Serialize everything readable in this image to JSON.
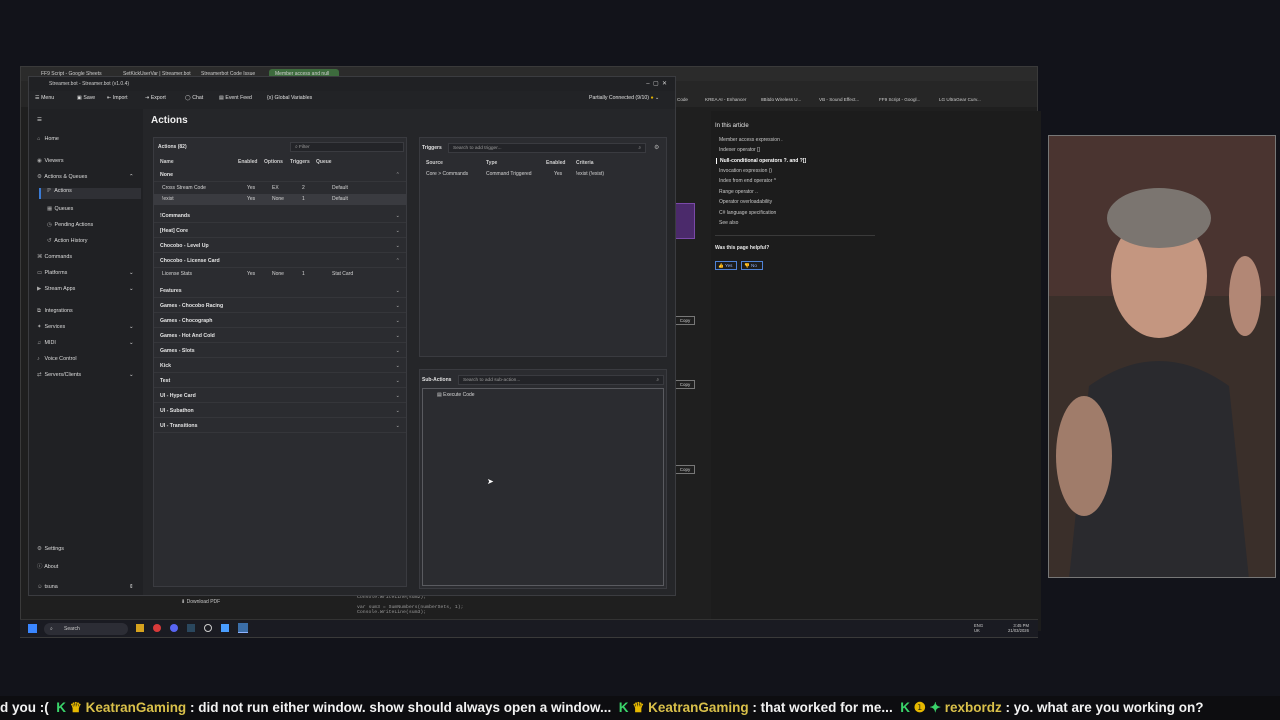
{
  "browser": {
    "tabs": [
      "FF9 Script - Google Sheets",
      "SetKickUserVar | Streamer.bot",
      "Streamerbot Code Issue",
      "Member access and null"
    ],
    "bookmarks": [
      "Code",
      "KREA AI - Enhancer",
      "8Bitdo Wireless U...",
      "VB - Sound Effect...",
      "FF9 Script - Googl...",
      "LG UltraGear Curv..."
    ],
    "article": {
      "toc_title": "In this article",
      "toc_items": [
        "Member access expression .",
        "Indexer operator []",
        "Null-conditional operators ?. and ?[]",
        "Invocation expression ()",
        "Index from end operator ^",
        "Range operator ..",
        "Operator overloadability",
        "C# language specification",
        "See also"
      ],
      "helpful_q": "Was this page helpful?",
      "yes": "Yes",
      "no": "No",
      "copy": "Copy",
      "download_pdf": "Download PDF",
      "code_line1": "Console.WriteLine(sum2);",
      "code_line2": "var sum3 = SumNumbers(numberSets, 1);",
      "code_line3": "Console.WriteLine(sum3);"
    }
  },
  "streamerbot": {
    "window_title": "Streamer.bot - Streamer.bot (v1.0.4)",
    "connection_status": "Partially Connected (9/10)",
    "toolbar": [
      "Menu",
      "Save",
      "Import",
      "Export",
      "Chat",
      "Event Feed",
      "Global Variables"
    ],
    "nav": [
      {
        "label": "Home",
        "icon": "home-icon"
      },
      {
        "label": "Viewers",
        "icon": "viewers-icon"
      },
      {
        "label": "Actions & Queues",
        "icon": "actions-icon"
      },
      {
        "label": "Actions",
        "icon": "actions-sub-icon"
      },
      {
        "label": "Queues",
        "icon": "queues-icon"
      },
      {
        "label": "Pending Actions",
        "icon": "pending-icon"
      },
      {
        "label": "Action History",
        "icon": "history-icon"
      },
      {
        "label": "Commands",
        "icon": "commands-icon"
      },
      {
        "label": "Platforms",
        "icon": "platforms-icon"
      },
      {
        "label": "Stream Apps",
        "icon": "stream-apps-icon"
      },
      {
        "label": "Integrations",
        "icon": "integrations-icon"
      },
      {
        "label": "Services",
        "icon": "services-icon"
      },
      {
        "label": "MIDI",
        "icon": "midi-icon"
      },
      {
        "label": "Voice Control",
        "icon": "voice-icon"
      },
      {
        "label": "Servers/Clients",
        "icon": "servers-icon"
      },
      {
        "label": "Settings",
        "icon": "settings-icon"
      },
      {
        "label": "About",
        "icon": "about-icon"
      },
      {
        "label": "tsuna",
        "icon": "user-icon"
      }
    ],
    "page_title": "Actions",
    "actions_panel": {
      "title": "Actions (82)",
      "filter_placeholder": "Filter",
      "columns": [
        "Name",
        "Enabled",
        "Options",
        "Triggers",
        "Queue"
      ],
      "groups": [
        {
          "name": "None",
          "rows": [
            {
              "name": "Cross Stream Code",
              "enabled": "Yes",
              "options": "EX",
              "triggers": "2",
              "queue": "Default"
            },
            {
              "name": "!exist",
              "enabled": "Yes",
              "options": "None",
              "triggers": "1",
              "queue": "Default"
            }
          ]
        },
        {
          "name": "!Commands",
          "rows": []
        },
        {
          "name": "[Heat] Core",
          "rows": []
        },
        {
          "name": "Chocobo - Level Up",
          "rows": []
        },
        {
          "name": "Chocobo - License Card",
          "rows": [
            {
              "name": "License Stats",
              "enabled": "Yes",
              "options": "None",
              "triggers": "1",
              "queue": "Stat Card"
            }
          ]
        },
        {
          "name": "Features",
          "rows": []
        },
        {
          "name": "Games - Chocobo Racing",
          "rows": []
        },
        {
          "name": "Games - Chocograph",
          "rows": []
        },
        {
          "name": "Games - Hot And Cold",
          "rows": []
        },
        {
          "name": "Games - Slots",
          "rows": []
        },
        {
          "name": "Kick",
          "rows": []
        },
        {
          "name": "Test",
          "rows": []
        },
        {
          "name": "UI - Hype Card",
          "rows": []
        },
        {
          "name": "UI - Subathon",
          "rows": []
        },
        {
          "name": "UI - Transitions",
          "rows": []
        }
      ]
    },
    "triggers_panel": {
      "title": "Triggers",
      "search_placeholder": "Search to add trigger...",
      "columns": [
        "Source",
        "Type",
        "Enabled",
        "Criteria"
      ],
      "rows": [
        {
          "source": "Core > Commands",
          "type": "Command Triggered",
          "enabled": "Yes",
          "criteria": "!exist (!exist)"
        }
      ]
    },
    "subactions_panel": {
      "title": "Sub-Actions",
      "search_placeholder": "Search to add sub-action...",
      "items": [
        "Execute Code"
      ]
    }
  },
  "taskbar": {
    "search": "Search",
    "lang": "ENG",
    "region": "UK",
    "time": "3:45 PM",
    "date": "21/03/2026"
  },
  "chat_ticker": [
    {
      "text": "d you :("
    },
    {
      "name": "KeatranGaming",
      "text": ": did not run either window. show should always open a window..."
    },
    {
      "name": "KeatranGaming",
      "text": ": that worked for me..."
    },
    {
      "name": "rexbordz",
      "text": ": yo. what are you working on?"
    }
  ],
  "colors": {
    "accent": "#3a7bd5",
    "ticker_name": "#d9c04a",
    "kick_green": "#3ad46a",
    "status_dot": "#e0b000"
  }
}
